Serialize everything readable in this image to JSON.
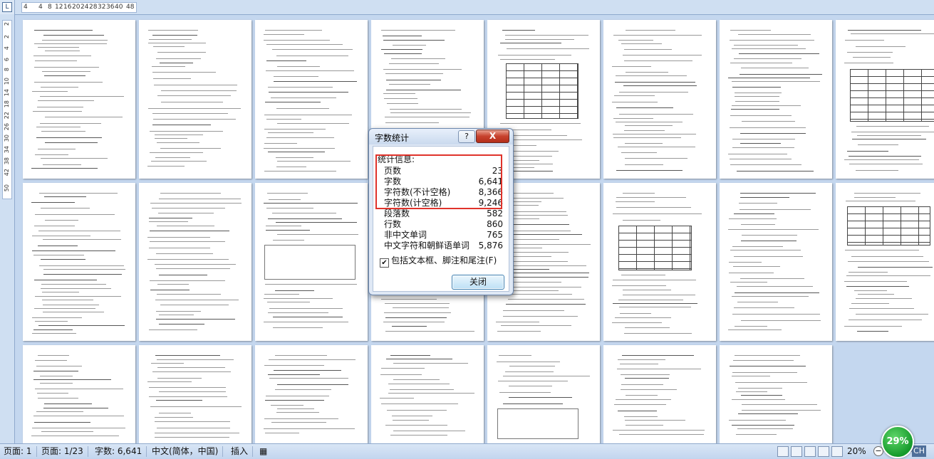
{
  "ruler": {
    "corner_glyph": "L",
    "h_ticks": [
      "4",
      "4",
      "8",
      "12",
      "16",
      "20",
      "24",
      "28",
      "32",
      "36",
      "40",
      "48"
    ],
    "v_ticks": [
      "2",
      "2",
      "4",
      "6",
      "8",
      "10",
      "14",
      "18",
      "22",
      "26",
      "30",
      "34",
      "38",
      "42",
      "50"
    ]
  },
  "dialog": {
    "title": "字数统计",
    "help_label": "?",
    "close_label": "X",
    "group_label": "统计信息:",
    "stats": [
      {
        "label": "页数",
        "value": "23"
      },
      {
        "label": "字数",
        "value": "6,641"
      },
      {
        "label": "字符数(不计空格)",
        "value": "8,366"
      },
      {
        "label": "字符数(计空格)",
        "value": "9,246"
      },
      {
        "label": "段落数",
        "value": "582"
      },
      {
        "label": "行数",
        "value": "860"
      },
      {
        "label": "非中文单词",
        "value": "765"
      },
      {
        "label": "中文字符和朝鲜语单词",
        "value": "5,876"
      }
    ],
    "checkbox_label": "包括文本框、脚注和尾注(F)",
    "checkbox_checked": true,
    "close_button_label": "关闭",
    "highlight_color": "#e0332b"
  },
  "statusbar": {
    "page": "页面: 1",
    "page_of": "页面: 1/23",
    "word_count": "字数: 6,641",
    "language": "中文(简体，中国)",
    "mode": "插入",
    "zoom": "20%",
    "lang_indicator": "CH"
  },
  "badge": {
    "value": "29%"
  }
}
